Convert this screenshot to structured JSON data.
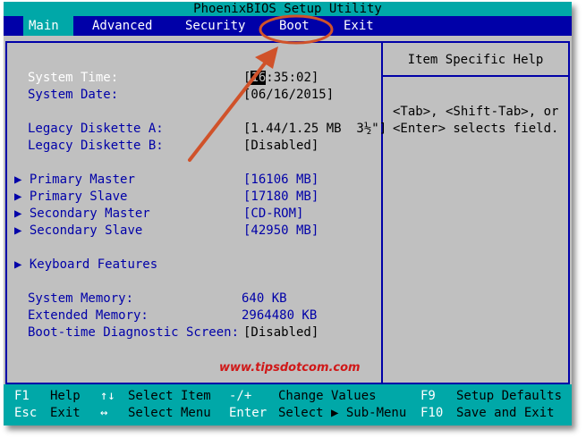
{
  "window": {
    "title": "PhoenixBIOS Setup Utility"
  },
  "menu": [
    {
      "label": "Main",
      "active": true
    },
    {
      "label": "Advanced",
      "active": false
    },
    {
      "label": "Security",
      "active": false
    },
    {
      "label": "Boot",
      "active": false
    },
    {
      "label": "Exit",
      "active": false
    }
  ],
  "settings": {
    "system_time": {
      "label": "System Time:",
      "value_prefix": "[",
      "value_cursor": "16",
      "value_rest": ":35:02]"
    },
    "system_date": {
      "label": "System Date:",
      "value": "[06/16/2015]"
    },
    "legacy_a": {
      "label": "Legacy Diskette A:",
      "value": "[1.44/1.25 MB  3½\"]"
    },
    "legacy_b": {
      "label": "Legacy Diskette B:",
      "value": "[Disabled]"
    },
    "primary_master": {
      "label": "Primary Master",
      "value": "[16106 MB]"
    },
    "primary_slave": {
      "label": "Primary Slave",
      "value": "[17180 MB]"
    },
    "secondary_master": {
      "label": "Secondary Master",
      "value": "[CD-ROM]"
    },
    "secondary_slave": {
      "label": "Secondary Slave",
      "value": "[42950 MB]"
    },
    "keyboard_features": {
      "label": "Keyboard Features"
    },
    "system_memory": {
      "label": "System Memory:",
      "value": "640 KB"
    },
    "extended_memory": {
      "label": "Extended Memory:",
      "value": "2964480 KB"
    },
    "boot_diag": {
      "label": "Boot-time Diagnostic Screen:",
      "value": "[Disabled]"
    }
  },
  "help": {
    "title": "Item Specific Help",
    "line1": "<Tab>, <Shift-Tab>, or",
    "line2": "<Enter> selects field."
  },
  "watermark": "www.tipsdotcom.com",
  "footer": {
    "row1": [
      {
        "key": "F1",
        "desc": "Help"
      },
      {
        "key": "↑↓",
        "desc": "Select Item"
      },
      {
        "key": "-/+",
        "desc": "Change Values"
      },
      {
        "key": "F9",
        "desc": "Setup Defaults"
      }
    ],
    "row2": [
      {
        "key": "Esc",
        "desc": "Exit"
      },
      {
        "key": "↔",
        "desc": "Select Menu"
      },
      {
        "key": "Enter",
        "desc": "Select ▶ Sub-Menu"
      },
      {
        "key": "F10",
        "desc": "Save and Exit"
      }
    ]
  },
  "colors": {
    "bios_blue": "#0000a8",
    "bios_cyan": "#00a8a8",
    "bios_gray": "#c0c0c0",
    "annotation_red": "#d0522a"
  },
  "icons": {
    "submenu_arrow": "▶",
    "annotation": "arrow-and-circle-highlight"
  }
}
